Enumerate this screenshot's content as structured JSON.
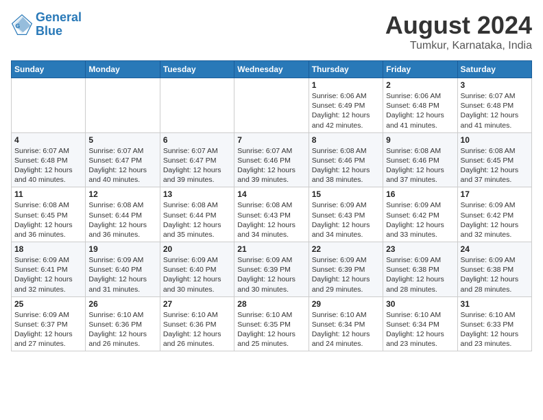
{
  "header": {
    "logo_text_general": "General",
    "logo_text_blue": "Blue",
    "title": "August 2024",
    "subtitle": "Tumkur, Karnataka, India"
  },
  "weekdays": [
    "Sunday",
    "Monday",
    "Tuesday",
    "Wednesday",
    "Thursday",
    "Friday",
    "Saturday"
  ],
  "weeks": [
    [
      {
        "day": "",
        "info": ""
      },
      {
        "day": "",
        "info": ""
      },
      {
        "day": "",
        "info": ""
      },
      {
        "day": "",
        "info": ""
      },
      {
        "day": "1",
        "info": "Sunrise: 6:06 AM\nSunset: 6:49 PM\nDaylight: 12 hours\nand 42 minutes."
      },
      {
        "day": "2",
        "info": "Sunrise: 6:06 AM\nSunset: 6:48 PM\nDaylight: 12 hours\nand 41 minutes."
      },
      {
        "day": "3",
        "info": "Sunrise: 6:07 AM\nSunset: 6:48 PM\nDaylight: 12 hours\nand 41 minutes."
      }
    ],
    [
      {
        "day": "4",
        "info": "Sunrise: 6:07 AM\nSunset: 6:48 PM\nDaylight: 12 hours\nand 40 minutes."
      },
      {
        "day": "5",
        "info": "Sunrise: 6:07 AM\nSunset: 6:47 PM\nDaylight: 12 hours\nand 40 minutes."
      },
      {
        "day": "6",
        "info": "Sunrise: 6:07 AM\nSunset: 6:47 PM\nDaylight: 12 hours\nand 39 minutes."
      },
      {
        "day": "7",
        "info": "Sunrise: 6:07 AM\nSunset: 6:46 PM\nDaylight: 12 hours\nand 39 minutes."
      },
      {
        "day": "8",
        "info": "Sunrise: 6:08 AM\nSunset: 6:46 PM\nDaylight: 12 hours\nand 38 minutes."
      },
      {
        "day": "9",
        "info": "Sunrise: 6:08 AM\nSunset: 6:46 PM\nDaylight: 12 hours\nand 37 minutes."
      },
      {
        "day": "10",
        "info": "Sunrise: 6:08 AM\nSunset: 6:45 PM\nDaylight: 12 hours\nand 37 minutes."
      }
    ],
    [
      {
        "day": "11",
        "info": "Sunrise: 6:08 AM\nSunset: 6:45 PM\nDaylight: 12 hours\nand 36 minutes."
      },
      {
        "day": "12",
        "info": "Sunrise: 6:08 AM\nSunset: 6:44 PM\nDaylight: 12 hours\nand 36 minutes."
      },
      {
        "day": "13",
        "info": "Sunrise: 6:08 AM\nSunset: 6:44 PM\nDaylight: 12 hours\nand 35 minutes."
      },
      {
        "day": "14",
        "info": "Sunrise: 6:08 AM\nSunset: 6:43 PM\nDaylight: 12 hours\nand 34 minutes."
      },
      {
        "day": "15",
        "info": "Sunrise: 6:09 AM\nSunset: 6:43 PM\nDaylight: 12 hours\nand 34 minutes."
      },
      {
        "day": "16",
        "info": "Sunrise: 6:09 AM\nSunset: 6:42 PM\nDaylight: 12 hours\nand 33 minutes."
      },
      {
        "day": "17",
        "info": "Sunrise: 6:09 AM\nSunset: 6:42 PM\nDaylight: 12 hours\nand 32 minutes."
      }
    ],
    [
      {
        "day": "18",
        "info": "Sunrise: 6:09 AM\nSunset: 6:41 PM\nDaylight: 12 hours\nand 32 minutes."
      },
      {
        "day": "19",
        "info": "Sunrise: 6:09 AM\nSunset: 6:40 PM\nDaylight: 12 hours\nand 31 minutes."
      },
      {
        "day": "20",
        "info": "Sunrise: 6:09 AM\nSunset: 6:40 PM\nDaylight: 12 hours\nand 30 minutes."
      },
      {
        "day": "21",
        "info": "Sunrise: 6:09 AM\nSunset: 6:39 PM\nDaylight: 12 hours\nand 30 minutes."
      },
      {
        "day": "22",
        "info": "Sunrise: 6:09 AM\nSunset: 6:39 PM\nDaylight: 12 hours\nand 29 minutes."
      },
      {
        "day": "23",
        "info": "Sunrise: 6:09 AM\nSunset: 6:38 PM\nDaylight: 12 hours\nand 28 minutes."
      },
      {
        "day": "24",
        "info": "Sunrise: 6:09 AM\nSunset: 6:38 PM\nDaylight: 12 hours\nand 28 minutes."
      }
    ],
    [
      {
        "day": "25",
        "info": "Sunrise: 6:09 AM\nSunset: 6:37 PM\nDaylight: 12 hours\nand 27 minutes."
      },
      {
        "day": "26",
        "info": "Sunrise: 6:10 AM\nSunset: 6:36 PM\nDaylight: 12 hours\nand 26 minutes."
      },
      {
        "day": "27",
        "info": "Sunrise: 6:10 AM\nSunset: 6:36 PM\nDaylight: 12 hours\nand 26 minutes."
      },
      {
        "day": "28",
        "info": "Sunrise: 6:10 AM\nSunset: 6:35 PM\nDaylight: 12 hours\nand 25 minutes."
      },
      {
        "day": "29",
        "info": "Sunrise: 6:10 AM\nSunset: 6:34 PM\nDaylight: 12 hours\nand 24 minutes."
      },
      {
        "day": "30",
        "info": "Sunrise: 6:10 AM\nSunset: 6:34 PM\nDaylight: 12 hours\nand 23 minutes."
      },
      {
        "day": "31",
        "info": "Sunrise: 6:10 AM\nSunset: 6:33 PM\nDaylight: 12 hours\nand 23 minutes."
      }
    ]
  ]
}
